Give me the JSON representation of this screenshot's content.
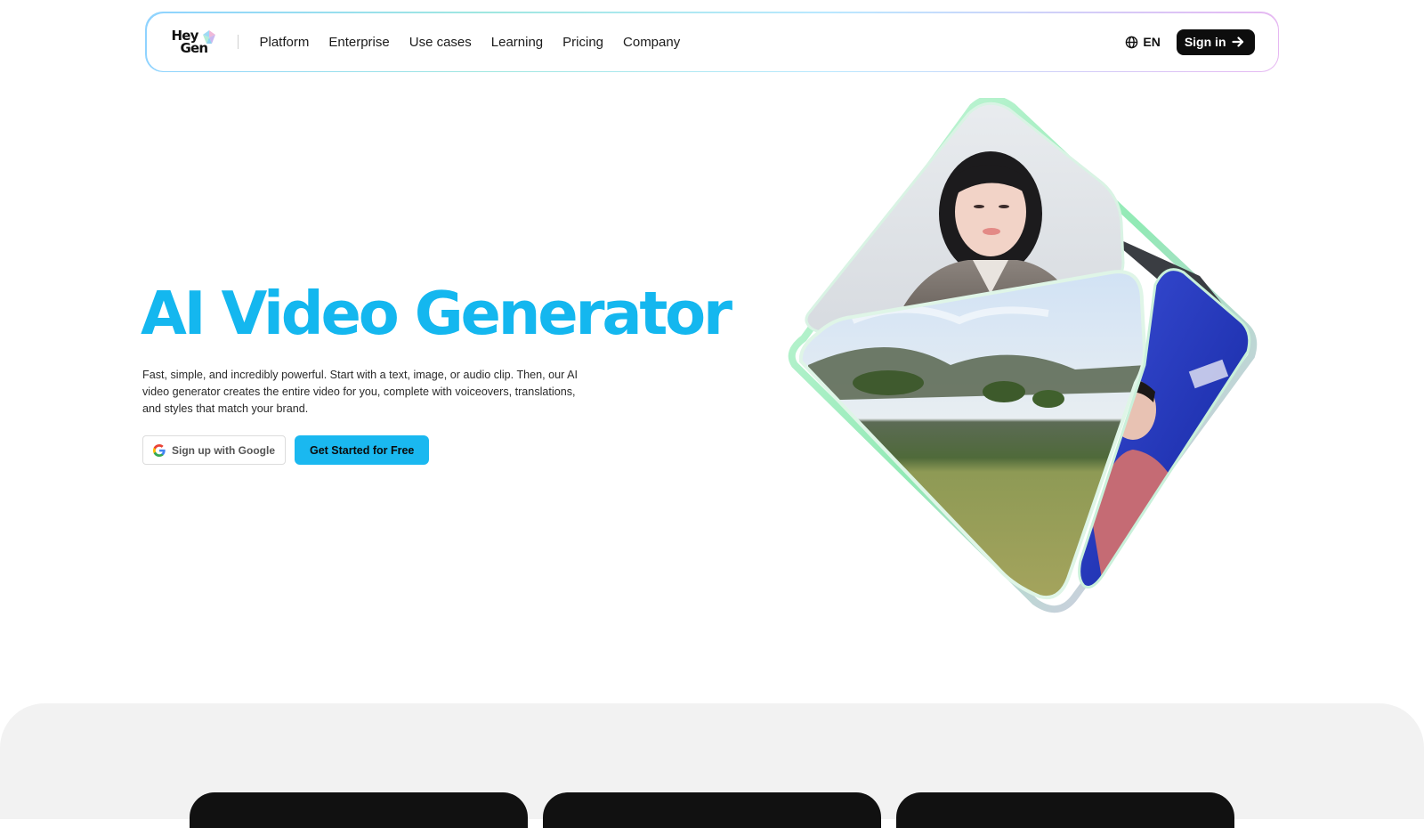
{
  "nav": {
    "logo_line1": "Hey",
    "logo_line2": "Gen",
    "links": [
      "Platform",
      "Enterprise",
      "Use cases",
      "Learning",
      "Pricing",
      "Company"
    ],
    "language": "EN",
    "signin_label": "Sign in"
  },
  "hero": {
    "title": "AI Video Generator",
    "description": "Fast, simple, and incredibly powerful. Start with a text, image, or audio clip. Then, our AI video generator creates the entire video for you, complete with voiceovers, translations, and styles that match your brand.",
    "google_button": "Sign up with Google",
    "primary_button": "Get Started for Free"
  },
  "colors": {
    "accent": "#14b7ef",
    "button_primary": "#1ab8f0",
    "signin_bg": "#0d0d0d",
    "lower_bg": "#f2f2f2"
  },
  "icons": {
    "logo": "heygen-logo-icon",
    "globe": "globe-icon",
    "arrow": "arrow-right-icon",
    "google": "google-g-icon"
  }
}
